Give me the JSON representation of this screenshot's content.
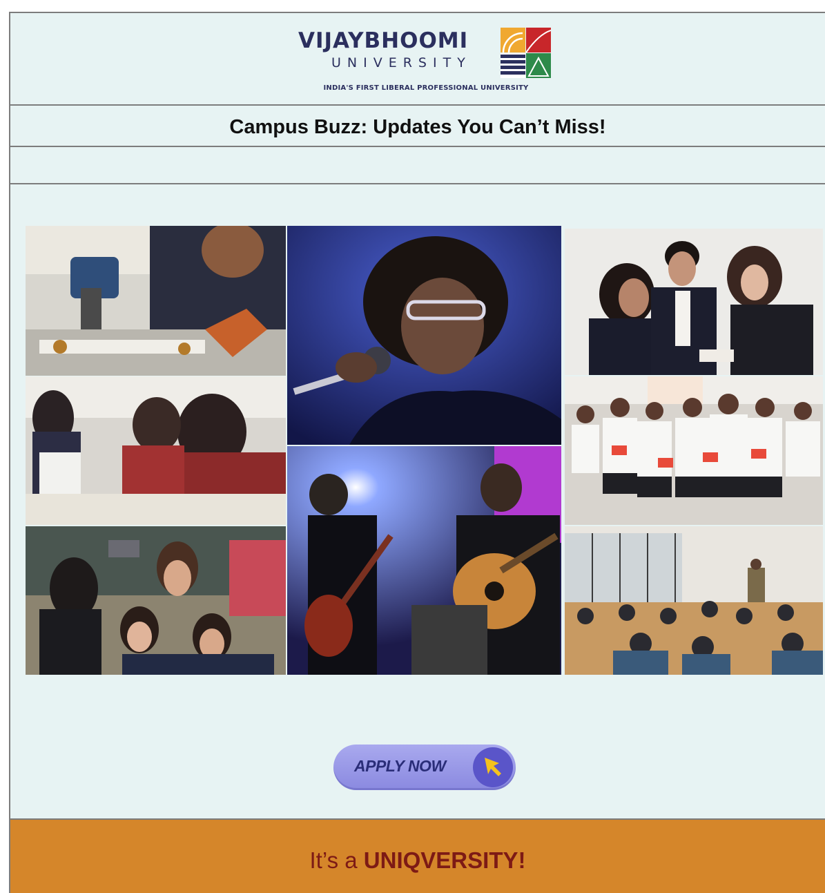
{
  "header": {
    "logo_title": "VIJAYBHOOMI",
    "logo_subtitle": "UNIVERSITY",
    "tagline": "INDIA'S FIRST LIBERAL PROFESSIONAL UNIVERSITY"
  },
  "headline": "Campus Buzz: Updates You Can’t Miss!",
  "collage": {
    "photos": [
      "drone-building-photo",
      "classroom-exam-photo",
      "selfie-group-photo",
      "singer-concert-photo",
      "guitar-band-photo",
      "business-students-photo",
      "marathon-run-photo",
      "lecture-hall-photo"
    ]
  },
  "apply": {
    "label": "APPLY NOW",
    "icon": "cursor-arrow-icon"
  },
  "footer": {
    "prefix": "It’s a ",
    "highlight": "UNIQVERSITY!"
  },
  "colors": {
    "background": "#e7f3f3",
    "footer": "#d5862a",
    "footer_text": "#7d1a15",
    "button": "#9d9ce9",
    "brand_navy": "#2b2f5e"
  }
}
